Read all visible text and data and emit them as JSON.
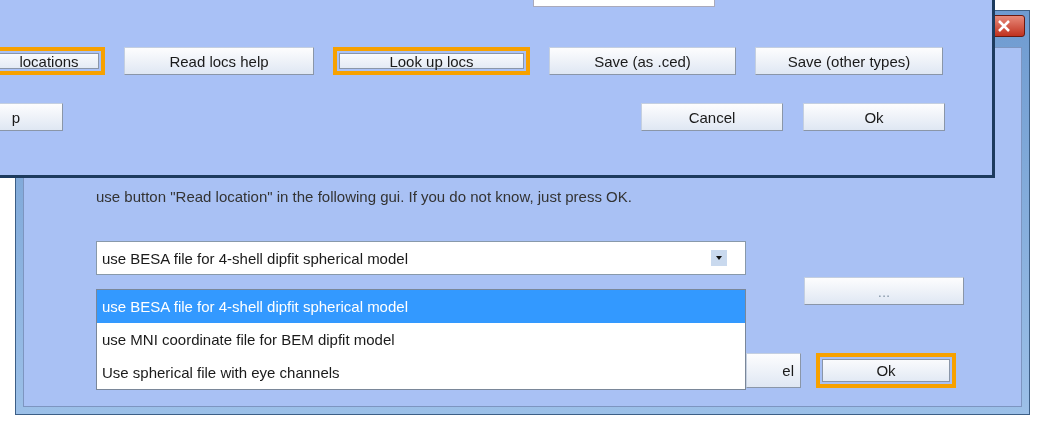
{
  "back_dialog": {
    "instruction": "use button \"Read location\" in the following gui. If you do not know, just press OK.",
    "dropdown": {
      "value": "use BESA file for 4-shell dipfit spherical model",
      "options": [
        {
          "label": "use BESA file for 4-shell dipfit spherical model",
          "selected": true
        },
        {
          "label": "use MNI coordinate file for BEM dipfit model",
          "selected": false
        },
        {
          "label": "Use spherical file with eye channels",
          "selected": false
        }
      ]
    },
    "browse_button": "...",
    "buttons": [
      {
        "label": "el",
        "highlighted": false
      },
      {
        "label": "Ok",
        "highlighted": true
      }
    ]
  },
  "front_dialog": {
    "row_buttons": [
      {
        "label": "locations",
        "highlighted": true
      },
      {
        "label": "Read locs help",
        "highlighted": false
      },
      {
        "label": "Look up locs",
        "highlighted": true
      },
      {
        "label": "Save (as .ced)",
        "highlighted": false
      },
      {
        "label": "Save (other types)",
        "highlighted": false
      }
    ],
    "left_buttons": [
      {
        "label": "p",
        "highlighted": false
      }
    ],
    "right_buttons": [
      {
        "label": "Cancel",
        "highlighted": false
      },
      {
        "label": "Ok",
        "highlighted": false
      }
    ]
  }
}
